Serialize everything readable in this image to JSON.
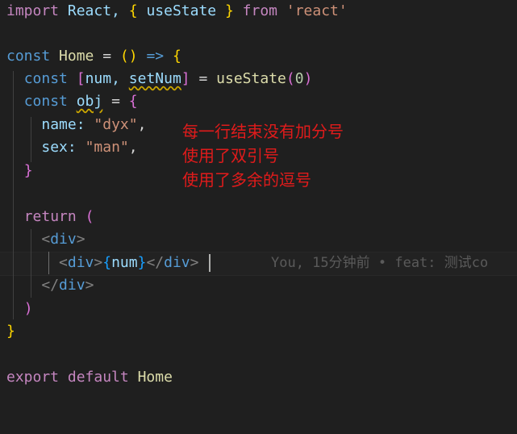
{
  "code": {
    "l1": {
      "kw_import": "import",
      "react": "React,",
      "brace_open": "{",
      "usestate": "useState",
      "brace_close": "}",
      "kw_from": "from",
      "module": "'react'"
    },
    "l3": {
      "kw_const": "const",
      "name": "Home",
      "eq": "=",
      "paren": "()",
      "arrow": "=>",
      "brace": "{"
    },
    "l4": {
      "kw_const": "const",
      "bracket_open": "[",
      "num": "num,",
      "setnum": "setNum",
      "bracket_close": "]",
      "eq": "=",
      "fn": "useState",
      "paren_open": "(",
      "zero": "0",
      "paren_close": ")"
    },
    "l5": {
      "kw_const": "const",
      "obj": "obj",
      "eq": "=",
      "brace": "{"
    },
    "l6": {
      "key": "name:",
      "value": "\"dyx\"",
      "comma": ","
    },
    "l7": {
      "key": "sex:",
      "value": "\"man\"",
      "comma": ","
    },
    "l8": {
      "brace": "}"
    },
    "l10": {
      "kw_return": "return",
      "paren": "("
    },
    "l11": {
      "lt": "<",
      "tag": "div",
      "gt": ">"
    },
    "l12": {
      "lt": "<",
      "tag": "div",
      "gt": ">",
      "expr_open": "{",
      "expr": "num",
      "expr_close": "}",
      "close_lt": "</",
      "close_tag": "div",
      "close_gt": ">"
    },
    "l13": {
      "lt": "</",
      "tag": "div",
      "gt": ">"
    },
    "l14": {
      "paren": ")"
    },
    "l15": {
      "brace": "}"
    },
    "l17": {
      "kw_export": "export",
      "kw_default": "default",
      "name": "Home"
    }
  },
  "blame": "You, 15分钟前 • feat: 测试co",
  "annotations": [
    "每一行结束没有加分号",
    "使用了双引号",
    "使用了多余的逗号"
  ]
}
